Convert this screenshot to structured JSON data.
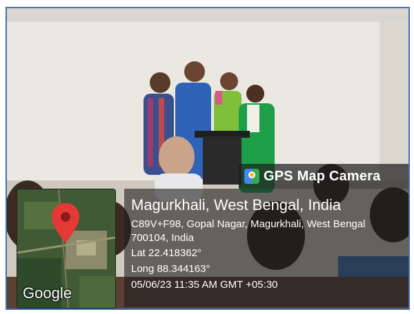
{
  "overlay": {
    "app_badge": "GPS Map Camera",
    "place_title": "Magurkhali, West Bengal, India",
    "address": "C89V+F98, Gopal Nagar, Magurkhali, West Bengal 700104, India",
    "lat": "Lat 22.418362°",
    "long": "Long 88.344163°",
    "datetime": "05/06/23 11:35 AM GMT +05:30",
    "map_logo": "Google"
  },
  "icons": {
    "app_icon": "gps-map-camera-icon",
    "pin": "map-pin-icon"
  },
  "colors": {
    "frame_border": "#3f6fb5",
    "pin": "#e53935"
  }
}
